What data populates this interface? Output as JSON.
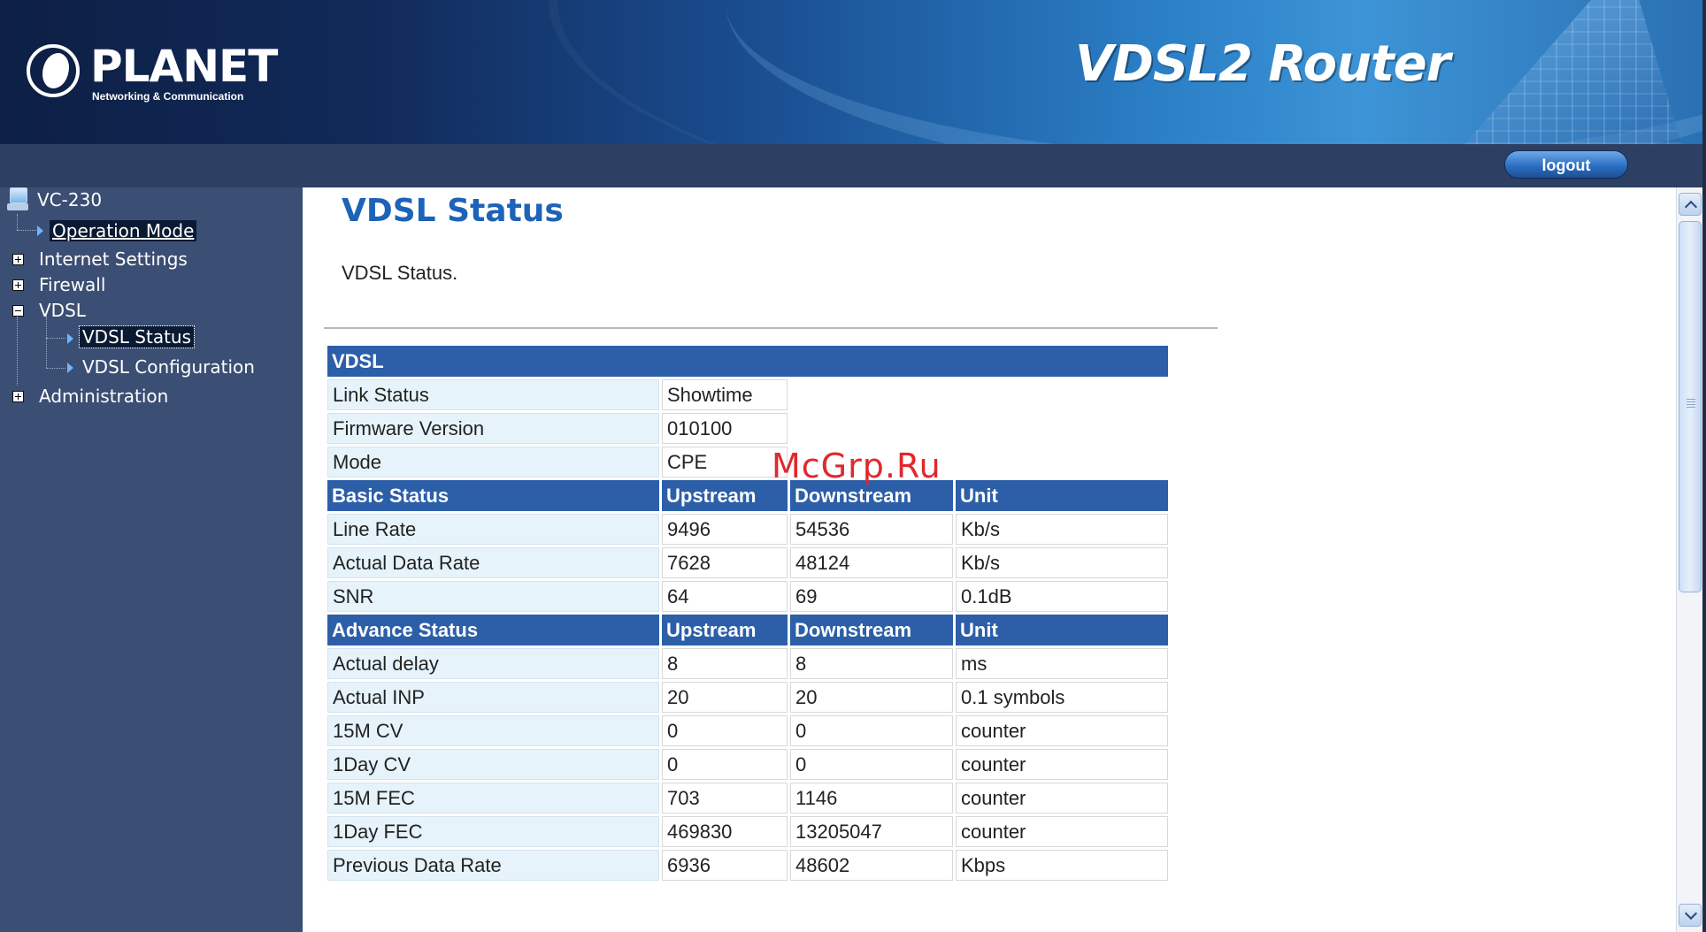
{
  "header": {
    "brand": "PLANET",
    "brand_tagline": "Networking & Communication",
    "product_title": "VDSL2 Router",
    "logout_label": "logout"
  },
  "sidebar": {
    "root": "VC-230",
    "items": [
      {
        "label": "Operation Mode",
        "type": "leaf",
        "state": "selected"
      },
      {
        "label": "Internet Settings",
        "type": "folder",
        "expanded": false
      },
      {
        "label": "Firewall",
        "type": "folder",
        "expanded": false
      },
      {
        "label": "VDSL",
        "type": "folder",
        "expanded": true
      },
      {
        "label": "VDSL Status",
        "type": "leaf",
        "state": "focused"
      },
      {
        "label": "VDSL Configuration",
        "type": "leaf"
      },
      {
        "label": "Administration",
        "type": "folder",
        "expanded": false
      }
    ]
  },
  "main": {
    "title": "VDSL Status",
    "description": "VDSL Status.",
    "vdsl_header": "VDSL",
    "info": [
      {
        "label": "Link Status",
        "value": "Showtime"
      },
      {
        "label": "Firmware Version",
        "value": "010100"
      },
      {
        "label": "Mode",
        "value": "CPE"
      }
    ],
    "basic": {
      "headers": [
        "Basic Status",
        "Upstream",
        "Downstream",
        "Unit"
      ],
      "rows": [
        [
          "Line Rate",
          "9496",
          "54536",
          "Kb/s"
        ],
        [
          "Actual Data Rate",
          "7628",
          "48124",
          "Kb/s"
        ],
        [
          "SNR",
          "64",
          "69",
          "0.1dB"
        ]
      ]
    },
    "advance": {
      "headers": [
        "Advance Status",
        "Upstream",
        "Downstream",
        "Unit"
      ],
      "rows": [
        [
          "Actual delay",
          "8",
          "8",
          "ms"
        ],
        [
          "Actual INP",
          "20",
          "20",
          "0.1 symbols"
        ],
        [
          "15M CV",
          "0",
          "0",
          "counter"
        ],
        [
          "1Day CV",
          "0",
          "0",
          "counter"
        ],
        [
          "15M FEC",
          "703",
          "1146",
          "counter"
        ],
        [
          "1Day FEC",
          "469830",
          "13205047",
          "counter"
        ],
        [
          "Previous Data Rate",
          "6936",
          "48602",
          "Kbps"
        ]
      ]
    }
  },
  "watermark": "McGrp.Ru",
  "colors": {
    "header_blue": "#2c5fa8",
    "title_blue": "#1d63b8",
    "sidebar_bg": "#3b4e73",
    "label_cell_bg": "#e6f3fb",
    "watermark_red": "#e0282e"
  }
}
